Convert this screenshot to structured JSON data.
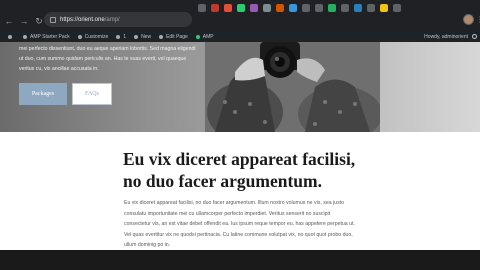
{
  "browser": {
    "url_host": "https://orient.one",
    "url_path": "/amp/",
    "back_glyph": "←",
    "forward_glyph": "→",
    "reload_glyph": "↻",
    "menu_glyph": "⋮",
    "extension_colors": [
      "#5f6368",
      "#c0392b",
      "#e74c3c",
      "#2ecc71",
      "#9b59b6",
      "#7f8c8d",
      "#d35400",
      "#3498db",
      "#5f6368",
      "#5f6368",
      "#27ae60",
      "#5f6368",
      "#2980b9",
      "#5f6368",
      "#f1c40f",
      "#5f6368"
    ]
  },
  "admin_bar": {
    "items": [
      {
        "label": "",
        "icon": "wordpress-icon"
      },
      {
        "label": "AMP Starter Pack",
        "icon": "home-icon"
      },
      {
        "label": "Customize",
        "icon": "brush-icon"
      },
      {
        "label": "1",
        "icon": "comments-icon"
      },
      {
        "label": "New",
        "icon": "plus-icon"
      },
      {
        "label": "Edit Page",
        "icon": "pencil-icon"
      },
      {
        "label": "AMP",
        "icon": "amp-icon"
      }
    ],
    "greeting": "Howdy, adminorient"
  },
  "hero": {
    "text": "mei perfecto dissentiunt, duo eu aeque aperiam lobortis. Sed magna eligendi ut duo, cum summo quidam periculis an. Has te suas everti, vel quaeque veritus cu, vix ancillae accusata in.",
    "packages_label": "Packages",
    "faqs_label": "FAQs"
  },
  "content": {
    "headline_line1": "Eu vix diceret appareat facilisi,",
    "headline_line2": "no duo facer argumentum.",
    "body": "Eu vix diceret appareat facilisi, no duo facer argumentum. Illum nostro volumus ne vix, sea justo consulatu importunitate mei cu ullamcorper perfecto imperdiet. Veritus senserit no suscipit consectetur vis, an est vitae debet offendit ea. Ius ipsum reque tempor eu, has appetere perpetua ut. Vel quas evertitur vix ne quodsi pertinacia. Cu latine commune volutpat vix, no quot quot probo duo, ullum dominig po in."
  },
  "colors": {
    "chrome_bg": "#202124",
    "admin_bar_bg": "#1d2327",
    "button_primary": "#8fa8c2",
    "headline": "#1a1a1a"
  }
}
